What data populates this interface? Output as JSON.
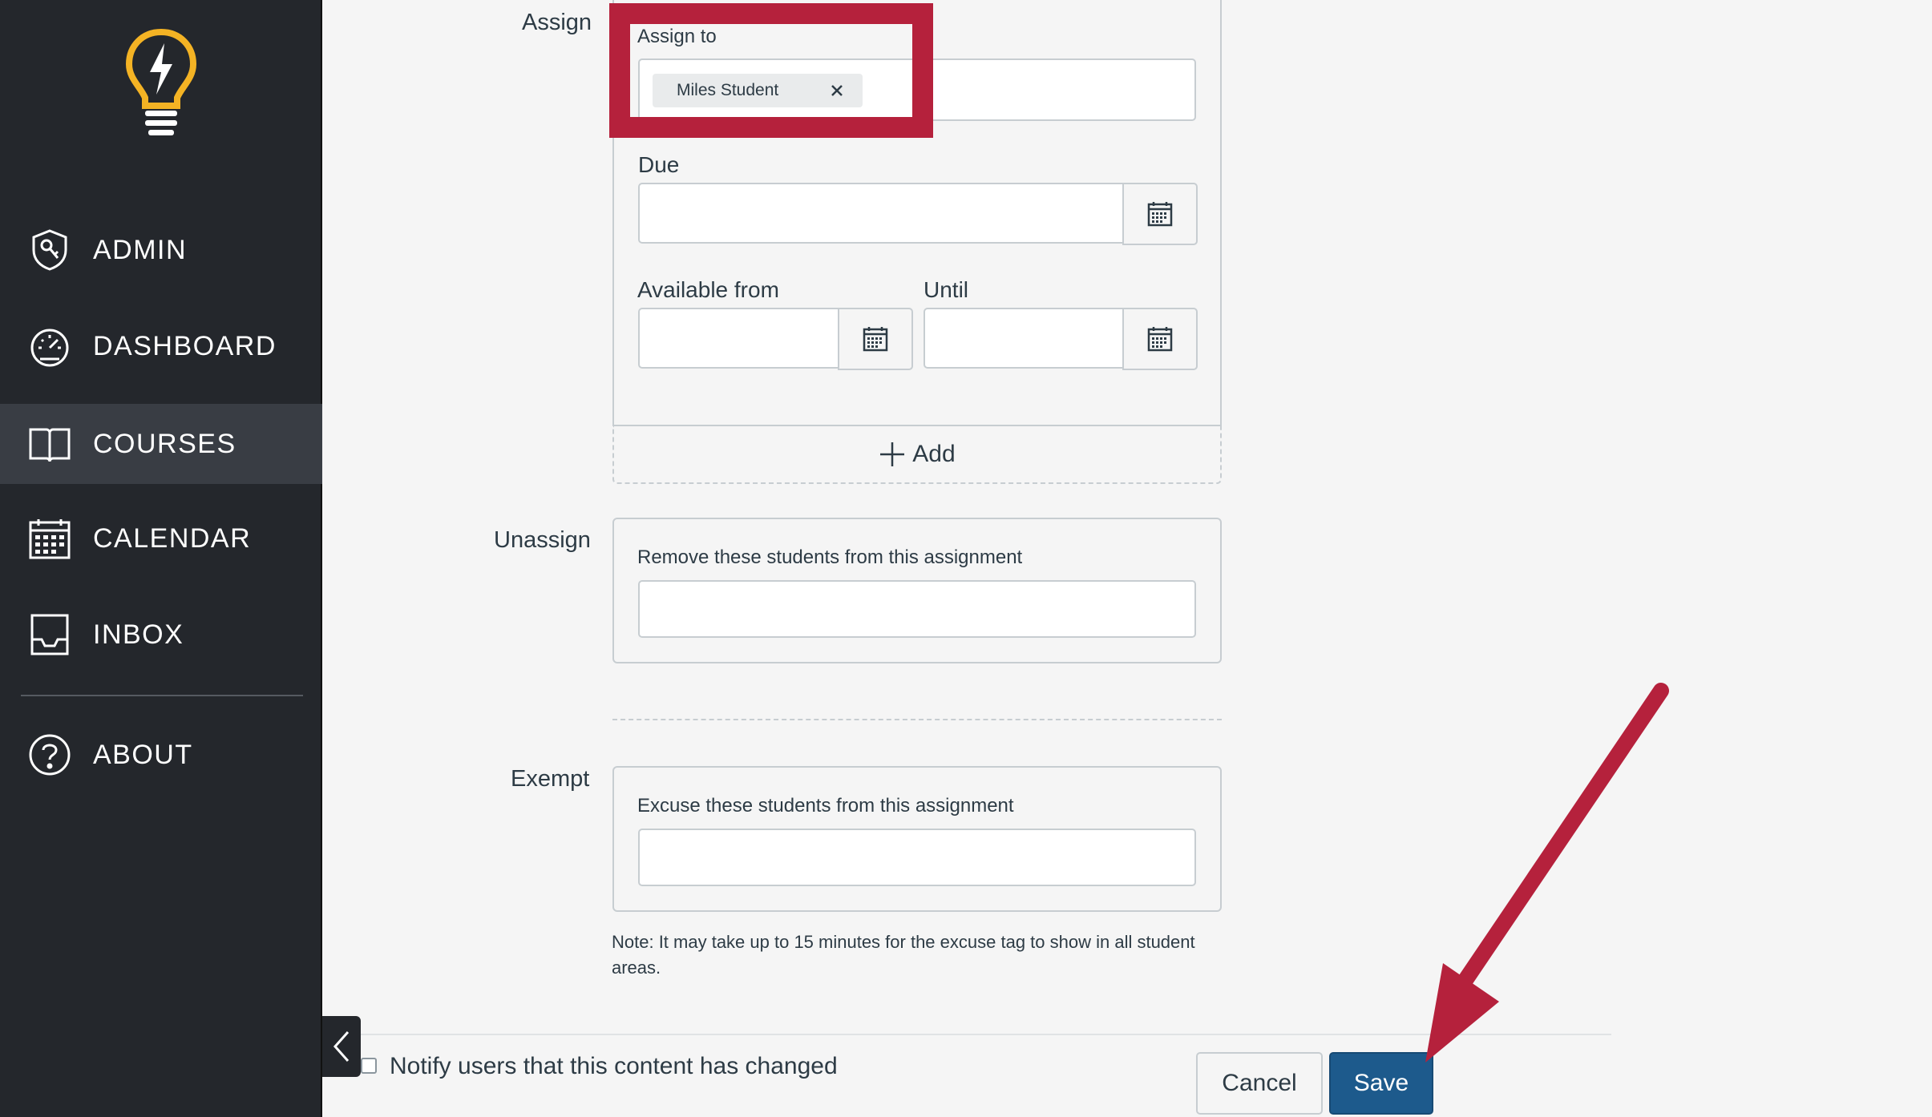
{
  "sidebar": {
    "items": [
      {
        "label": "ADMIN",
        "icon": "admin-shield-icon",
        "active": false
      },
      {
        "label": "DASHBOARD",
        "icon": "dashboard-gauge-icon",
        "active": false
      },
      {
        "label": "COURSES",
        "icon": "courses-book-icon",
        "active": true
      },
      {
        "label": "CALENDAR",
        "icon": "calendar-icon",
        "active": false
      },
      {
        "label": "INBOX",
        "icon": "inbox-tray-icon",
        "active": false
      }
    ],
    "about": {
      "label": "ABOUT",
      "icon": "help-circle-icon"
    },
    "colors": {
      "background": "#24272c",
      "active": "#393d44",
      "logo": "#f4b324"
    }
  },
  "assign": {
    "section_label": "Assign",
    "assign_to_label": "Assign to",
    "assignees": [
      "Miles Student"
    ],
    "due_label": "Due",
    "due_value": "",
    "available_from_label": "Available from",
    "available_from_value": "",
    "until_label": "Until",
    "until_value": "",
    "add_label": "Add"
  },
  "unassign": {
    "section_label": "Unassign",
    "field_label": "Remove these students from this assignment",
    "value": ""
  },
  "exempt": {
    "section_label": "Exempt",
    "field_label": "Excuse these students from this assignment",
    "value": "",
    "note": "Note: It may take up to 15 minutes for the excuse tag to show in all student areas."
  },
  "footer": {
    "notify_label": "Notify users that this content has changed",
    "notify_checked": false,
    "cancel_label": "Cancel",
    "save_label": "Save"
  },
  "annotation": {
    "color": "#b5213c"
  }
}
